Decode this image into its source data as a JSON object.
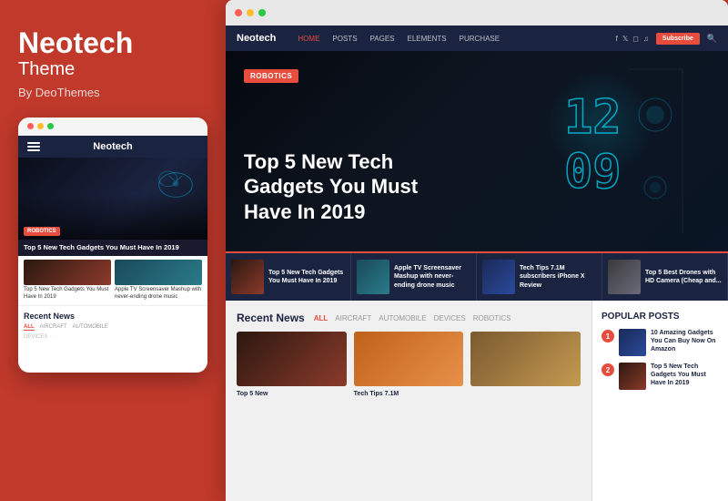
{
  "brand": {
    "name": "Neotech",
    "subtitle": "Theme",
    "by": "By DeoThemes"
  },
  "nav": {
    "logo": "Neotech",
    "items": [
      {
        "label": "HOME",
        "active": true
      },
      {
        "label": "POSTS",
        "active": false
      },
      {
        "label": "PAGES",
        "active": false
      },
      {
        "label": "ELEMENTS",
        "active": false
      },
      {
        "label": "PURCHASE",
        "active": false
      }
    ],
    "subscribe": "Subscribe"
  },
  "hero": {
    "category": "ROBOTICS",
    "title": "Top 5 New Tech Gadgets You Must Have In 2019"
  },
  "thumbStrip": {
    "items": [
      {
        "text": "Top 5 New Tech Gadgets You Must Have In 2019"
      },
      {
        "text": "Apple TV Screensaver Mashup with never-ending drone music"
      },
      {
        "text": "Tech Tips 7.1M subscribers iPhone X Review"
      },
      {
        "text": "Top 5 Best Drones with HD Camera (Cheap and..."
      }
    ]
  },
  "recentNews": {
    "title": "Recent News",
    "tabs": [
      "ALL",
      "AIRCRAFT",
      "AUTOMOBILE",
      "DEVICES",
      "ROBOTICS"
    ],
    "items": [
      {
        "label": "Top 5 New"
      },
      {
        "label": "Tech Tips 7.1M"
      },
      {
        "label": ""
      }
    ]
  },
  "popularPosts": {
    "title": "POPULAR POSTS",
    "items": [
      {
        "num": "1",
        "text": "10 Amazing Gadgets You Can Buy Now On Amazon"
      },
      {
        "num": "2",
        "text": "Top 5 New Tech Gadgets You Must Have In 2019"
      }
    ]
  },
  "mobile": {
    "nav_logo": "Neotech",
    "hero_badge": "ROBOTICS",
    "hero_title": "Top 5 New Tech Gadgets You Must Have In 2019",
    "card1_text": "Top 5 New Tech Gadgets You Must Have In 2019",
    "card2_text": "Apple TV Screensaver Mashup with never-ending drone music",
    "recent_title": "Recent News",
    "recent_tabs": [
      "ALL",
      "AIRCRAFT",
      "AUTOMOBILE"
    ]
  }
}
